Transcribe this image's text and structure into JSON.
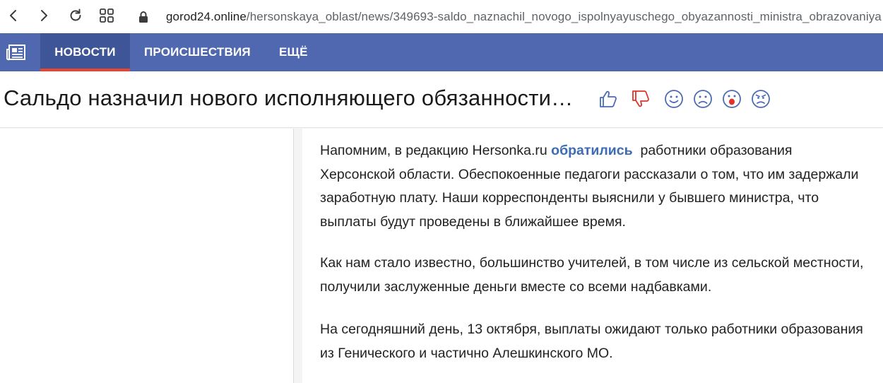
{
  "browser": {
    "back_icon": "chevron-left-icon",
    "forward_icon": "chevron-right-icon",
    "reload_icon": "reload-icon",
    "apps_icon": "grid-icon",
    "lock_icon": "lock-icon",
    "url_domain": "gorod24.online",
    "url_path": "/hersonskaya_oblast/news/349693-saldo_naznachil_novogo_ispolnyayuschego_obyazannosti_ministra_obrazovaniya"
  },
  "site_nav": {
    "logo_icon": "newspaper-icon",
    "items": [
      {
        "label": "НОВОСТИ",
        "active": true
      },
      {
        "label": "ПРОИСШЕСТВИЯ",
        "active": false
      },
      {
        "label": "ЕЩЁ",
        "active": false
      }
    ],
    "accent_color": "#e8452f",
    "bar_color": "#4f68b0"
  },
  "title": {
    "text": "Сальдо назначил нового исполняющего обязанности…",
    "reactions": [
      "thumbs-up-icon",
      "thumbs-down-icon",
      "smile-icon",
      "sad-icon",
      "surprised-icon",
      "angry-icon"
    ]
  },
  "article": {
    "p1_before": "Напомним, в редакцию Hersonka.ru ",
    "p1_link": "обратились",
    "p1_after": "  работники образования Херсонской области. Обеспокоенные педагоги рассказали о том, что им задержали заработную плату. Наши корреспонденты выяснили у бывшего министра, что выплаты будут проведены в ближайшее время.",
    "p2": "Как нам стало известно, большинство учителей, в том числе из сельской местности, получили заслуженные деньги вместе со всеми надбавками.",
    "p3": "На сегодняшний день, 13 октября, выплаты ожидают только работники образования из Генического и частично Алешкинского МО."
  }
}
